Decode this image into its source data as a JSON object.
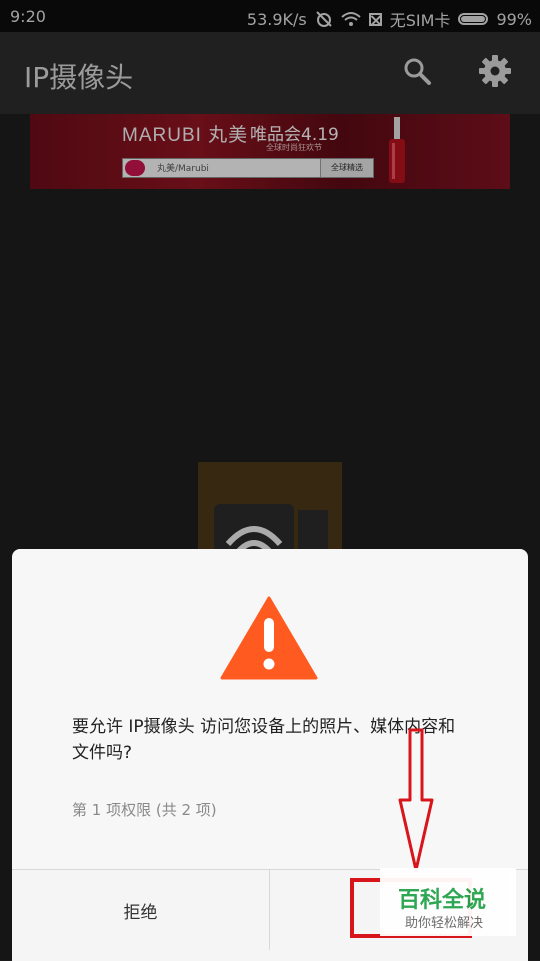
{
  "status_bar": {
    "time": "9:20",
    "net_speed": "53.9K/s",
    "sim": "无SIM卡",
    "battery": "99%",
    "battery_fill": 0.99
  },
  "app_bar": {
    "title": "IP摄像头",
    "icons": [
      "search-icon",
      "gear-icon"
    ]
  },
  "banner": {
    "brand": "MARUBI 丸美",
    "headline": "唯品会4.19",
    "tagline": "全球时尚狂欢节",
    "search_text": "丸美/Marubi",
    "search_button": "全球精选"
  },
  "dialog": {
    "icon": "warning-icon",
    "message": "要允许 IP摄像头 访问您设备上的照片、媒体内容和文件吗?",
    "count": "第 1 项权限 (共 2 项)",
    "deny_label": "拒绝",
    "allow_label": ""
  },
  "watermark": {
    "title": "百科全说",
    "subtitle": "助你轻松解决"
  },
  "colors": {
    "warning": "#ff5a1f",
    "annotation": "#d8151b",
    "watermark_green": "#23a34a"
  }
}
